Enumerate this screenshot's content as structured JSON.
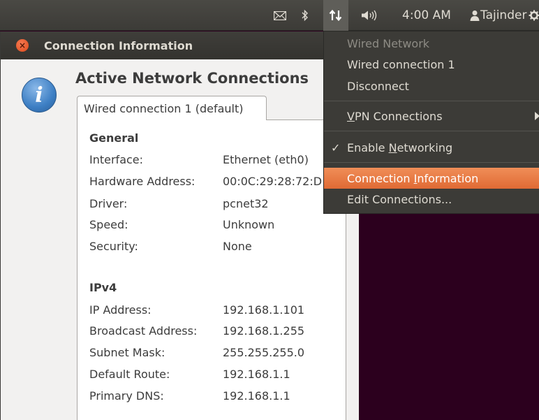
{
  "top_panel": {
    "time": "4:00 AM",
    "user": "Tajinder",
    "icons": [
      "mail-icon",
      "bluetooth-icon",
      "network-icon",
      "sound-icon",
      "user-icon",
      "gear-icon"
    ]
  },
  "dialog": {
    "title": "Connection Information",
    "heading": "Active Network Connections",
    "tab_label": "Wired connection 1 (default)",
    "general": {
      "title": "General",
      "rows": [
        {
          "label": "Interface:",
          "value": "Ethernet (eth0)"
        },
        {
          "label": "Hardware Address:",
          "value": "00:0C:29:28:72:D"
        },
        {
          "label": "Driver:",
          "value": "pcnet32"
        },
        {
          "label": "Speed:",
          "value": "Unknown"
        },
        {
          "label": "Security:",
          "value": "None"
        }
      ]
    },
    "ipv4": {
      "title": "IPv4",
      "rows": [
        {
          "label": "IP Address:",
          "value": "192.168.1.101"
        },
        {
          "label": "Broadcast Address:",
          "value": "192.168.1.255"
        },
        {
          "label": "Subnet Mask:",
          "value": "255.255.255.0"
        },
        {
          "label": "Default Route:",
          "value": "192.168.1.1"
        },
        {
          "label": "Primary DNS:",
          "value": "192.168.1.1"
        }
      ]
    }
  },
  "menu": {
    "wired_network": "Wired Network",
    "wired_connection": "Wired connection 1",
    "disconnect": "Disconnect",
    "vpn_prefix": "V",
    "vpn_rest": "PN Connections",
    "check": "✓",
    "enable_prefix": "Enable ",
    "enable_underlined": "N",
    "enable_rest": "etworking",
    "connection_info_prefix": "Connection ",
    "connection_info_underlined": "I",
    "connection_info_rest": "nformation",
    "edit_connections": "Edit Connections..."
  },
  "colors": {
    "desktop": "#2c001e",
    "panel": "#3c3b37",
    "highlight": "#e8743b",
    "dialog_bg": "#f2f1f0"
  }
}
